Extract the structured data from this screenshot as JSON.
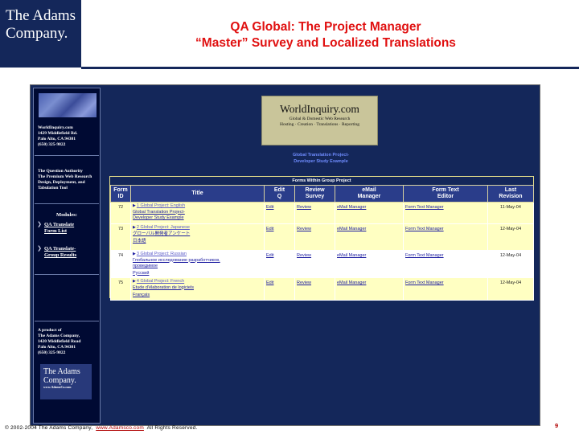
{
  "slide": {
    "logo_line1": "The Adams",
    "logo_line2": "Company.",
    "title_line1": "QA Global: The Project Manager",
    "title_line2": "“Master” Survey and Localized Translations",
    "footer_copyright": "© 2002-2004 The Adams Company,",
    "footer_url": "www.Adamsco.com",
    "footer_rights": "All Rights Reserved.",
    "page_number": "9",
    "colors": {
      "brand_navy": "#14275a",
      "title_red": "#e01010"
    }
  },
  "sidebar": {
    "address": [
      "WorldInquiry.com",
      "1429 Middlefield Rd.",
      "Palo Alto, CA  94301",
      "(650) 325-9822"
    ],
    "tagline": [
      "The Question Authority",
      "The Premium Web Research",
      "Design, Deployment, and",
      "Tabulation Tool"
    ],
    "modules_heading": "Modules:",
    "links": [
      {
        "line1": "QA Translate",
        "line2": "Form List"
      },
      {
        "line1": "QA Translate-",
        "line2": "Group Results"
      }
    ],
    "product_of": [
      "A product of",
      "The Adams Company,",
      "1420 Middlefield Road",
      "Palo Alto, CA  94301",
      "(650) 325-9822"
    ],
    "logo_line1": "The Adams",
    "logo_line2": "Company.",
    "logo_url": "www.AdamsCo.com",
    "icons": {
      "globe": "globe-image-icon",
      "bullet": "arrow-bullet-icon"
    }
  },
  "main": {
    "banner_title": "WorldInquiry.com",
    "banner_sub1": "Global & Domestic Web Research",
    "banner_sub2": "Hosting · Creation · Translations · Reporting",
    "project_title_line1": "Global Translation Project-",
    "project_title_line2": "Developer Study Example",
    "forms_caption": "Forms Within Group Project",
    "columns": [
      {
        "l1": "Form",
        "l2": "ID"
      },
      {
        "l1": "Title",
        "l2": ""
      },
      {
        "l1": "Edit",
        "l2": "Q"
      },
      {
        "l1": "Review",
        "l2": "Survey"
      },
      {
        "l1": "eMail",
        "l2": "Manager"
      },
      {
        "l1": "Form Text",
        "l2": "Editor"
      },
      {
        "l1": "Last",
        "l2": "Revision"
      }
    ],
    "rows": [
      {
        "id": "72",
        "title_head": "1 Global Project: English",
        "title_l1": "Global Translation Project-",
        "title_l2": "Developer Study Example",
        "title_l3": "",
        "edit": "Edit",
        "review": "Review",
        "email": "eMail Manager",
        "form_text": "Form Text Manager",
        "last_rev": "11-May-04"
      },
      {
        "id": "73",
        "title_head": "2 Global Project: Japanese",
        "title_l1": "グローバル開発者アンケート",
        "title_l2": "",
        "title_l3": "日本語",
        "edit": "Edit",
        "review": "Review",
        "email": "eMail Manager",
        "form_text": "Form Text Manager",
        "last_rev": "12-May-04"
      },
      {
        "id": "74",
        "title_head": "3 Global Project: Russian",
        "title_l1": "Глобальное исследование разработчиков,",
        "title_l2": "проведимое",
        "title_l3": "Русский",
        "edit": "Edit",
        "review": "Review",
        "email": "eMail Manager",
        "form_text": "Form Text Manager",
        "last_rev": "12-May-04"
      },
      {
        "id": "75",
        "title_head": "4 Global Project: French",
        "title_l1": "Etude d'élaboration de logiciels",
        "title_l2": "",
        "title_l3": "Français",
        "edit": "Edit",
        "review": "Review",
        "email": "eMail Manager",
        "form_text": "Form Text Manager",
        "last_rev": "12-May-04"
      }
    ]
  }
}
